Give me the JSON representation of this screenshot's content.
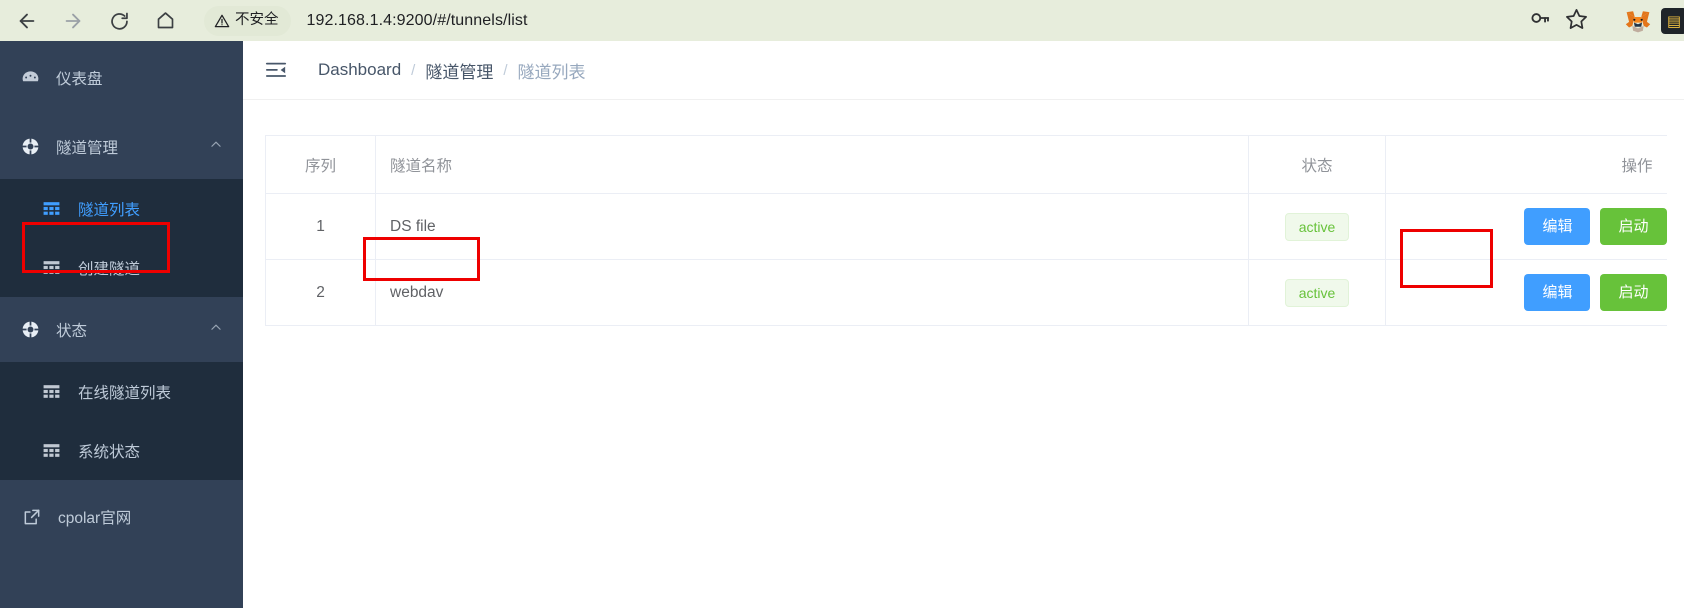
{
  "browser": {
    "back_icon": "arrow-left-icon",
    "forward_icon": "arrow-right-icon",
    "reload_icon": "reload-icon",
    "home_icon": "home-icon",
    "security_label": "不安全",
    "security_icon": "warning-triangle-icon",
    "url": "192.168.1.4:9200/#/tunnels/list",
    "password_icon": "key-icon",
    "bookmark_icon": "star-icon",
    "extension_metamask": "metamask-fox-icon",
    "extension_second": "extension-icon",
    "toolbar_bg": "#e7eddc"
  },
  "sidebar": {
    "bg": "#324157",
    "submenu_bg": "#1f2d3d",
    "active_color": "#409eff",
    "items": [
      {
        "label": "仪表盘",
        "icon": "dashboard-gauge-icon",
        "type": "link"
      },
      {
        "label": "隧道管理",
        "icon": "tunnel-circle-icon",
        "type": "group",
        "arrow": "chevron-up-icon",
        "children": [
          {
            "label": "隧道列表",
            "icon": "grid-icon",
            "active": true
          },
          {
            "label": "创建隧道",
            "icon": "grid-icon",
            "active": false
          }
        ]
      },
      {
        "label": "状态",
        "icon": "status-circle-icon",
        "type": "group",
        "arrow": "chevron-up-icon",
        "children": [
          {
            "label": "在线隧道列表",
            "icon": "grid-icon",
            "active": false
          },
          {
            "label": "系统状态",
            "icon": "grid-icon",
            "active": false
          }
        ]
      },
      {
        "label": "cpolar官网",
        "icon": "external-link-icon",
        "type": "link"
      }
    ]
  },
  "topbar": {
    "fold_icon": "menu-fold-icon",
    "breadcrumb": [
      {
        "label": "Dashboard",
        "current": false
      },
      {
        "label": "隧道管理",
        "current": false
      },
      {
        "label": "隧道列表",
        "current": true
      }
    ],
    "separator": "/"
  },
  "table": {
    "columns": [
      {
        "key": "seq",
        "label": "序列"
      },
      {
        "key": "name",
        "label": "隧道名称"
      },
      {
        "key": "status",
        "label": "状态"
      },
      {
        "key": "op",
        "label": "操作"
      }
    ],
    "rows": [
      {
        "seq": "1",
        "name": "DS file",
        "status": "active",
        "edit": "编辑",
        "start": "启动"
      },
      {
        "seq": "2",
        "name": "webdav",
        "status": "active",
        "edit": "编辑",
        "start": "启动"
      }
    ],
    "badge_color": "#67c23a",
    "badge_bg": "#f0f9eb",
    "edit_color": "#409eff",
    "start_color": "#67c23a"
  },
  "annotations": {
    "color": "#ee0000",
    "boxes": [
      {
        "name": "sidebar-tunnel-list-highlight"
      },
      {
        "name": "tunnel-name-cell-highlight"
      },
      {
        "name": "edit-button-highlight"
      }
    ]
  }
}
